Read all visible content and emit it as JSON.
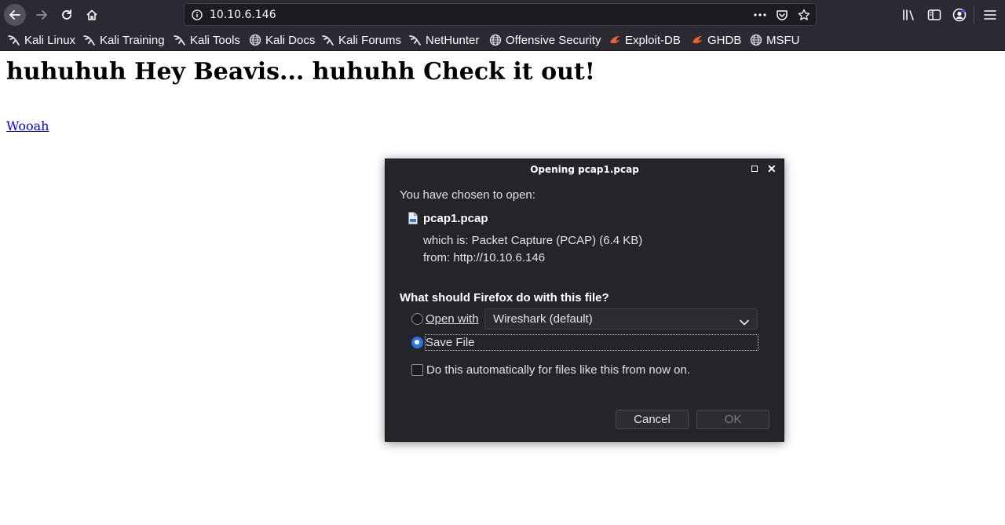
{
  "browser": {
    "url": "10.10.6.146"
  },
  "bookmarks": [
    {
      "label": "Kali Linux",
      "icon": "kali-dragon-icon"
    },
    {
      "label": "Kali Training",
      "icon": "kali-dragon-icon"
    },
    {
      "label": "Kali Tools",
      "icon": "kali-dragon-icon"
    },
    {
      "label": "Kali Docs",
      "icon": "globe-icon"
    },
    {
      "label": "Kali Forums",
      "icon": "kali-dragon-icon"
    },
    {
      "label": "NetHunter",
      "icon": "kali-dragon-icon"
    },
    {
      "label": "Offensive Security",
      "icon": "globe-icon"
    },
    {
      "label": "Exploit-DB",
      "icon": "exploit-db-icon"
    },
    {
      "label": "GHDB",
      "icon": "exploit-db-icon"
    },
    {
      "label": "MSFU",
      "icon": "globe-icon"
    }
  ],
  "page": {
    "heading": "huhuhuh Hey Beavis... huhuhh Check it out!",
    "link": "Wooah"
  },
  "dialog": {
    "title": "Opening pcap1.pcap",
    "chosen_label": "You have chosen to open:",
    "file_name": "pcap1.pcap",
    "which_is": "which is:  Packet Capture (PCAP) (6.4 KB)",
    "from": "from:  http://10.10.6.146",
    "question": "What should Firefox do with this file?",
    "open_with_label": "Open with",
    "open_with_app": "Wireshark (default)",
    "save_file_label": "Save File",
    "auto_label": "Do this automatically for files like this from now on.",
    "cancel": "Cancel",
    "ok": "OK",
    "selected_option": "save-file"
  },
  "colors": {
    "toolbar_bg": "#2b2a33",
    "dialog_bg": "#24252b",
    "link": "#0000ee",
    "radio_selected": "#2a76dd"
  }
}
